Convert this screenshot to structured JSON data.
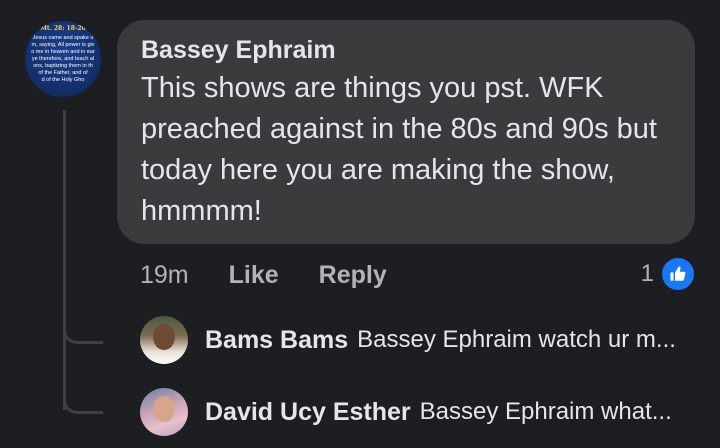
{
  "comment": {
    "avatar": {
      "ref": "Mt. 28: 18-20",
      "verse": "Jesus came and spake u\nm, saying, All power is giv\no me in heaven and in ear\nye therefore, and teach al\nons, baptizing them in th\n of the Father, and of\nd of the Holy Gho"
    },
    "author": "Bassey Ephraim",
    "text": "This shows are things you pst. WFK preached against in the 80s and 90s but today here you are making the show, hmmmm!",
    "time": "19m",
    "like_label": "Like",
    "reply_label": "Reply",
    "reaction_count": "1",
    "reaction_icon": "thumbs-up-icon",
    "reaction_color": "#1877f2"
  },
  "replies": [
    {
      "name": "Bams Bams",
      "snippet": "Bassey Ephraim watch ur m..."
    },
    {
      "name": "David Ucy Esther",
      "snippet": "Bassey Ephraim what..."
    }
  ],
  "colors": {
    "background": "#1c1e21",
    "bubble": "#3a3b3c",
    "text": "#e4e6eb",
    "secondary": "#b0b3b8"
  }
}
